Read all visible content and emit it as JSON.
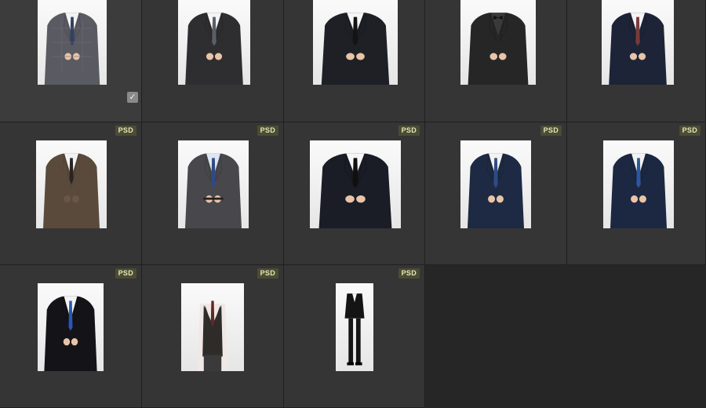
{
  "grid": {
    "background": "#262626",
    "cell_background": "#353535",
    "badge_color": "#4a4d33",
    "items": [
      {
        "badge": "",
        "selected": true,
        "suit": "#5a5a62",
        "tie": "#34405e",
        "shirt": "#f2f2f2",
        "pattern": "check"
      },
      {
        "badge": "",
        "selected": false,
        "suit": "#2e2e30",
        "tie": "#5a5e66",
        "shirt": "#f4f4f4",
        "pattern": "stripe-tie"
      },
      {
        "badge": "",
        "selected": false,
        "suit": "#1f2026",
        "tie": "#141414",
        "shirt": "#f6f6f6",
        "pattern": "plain"
      },
      {
        "badge": "",
        "selected": false,
        "suit": "#262626",
        "tie": "#111111",
        "shirt": "#3a3a3a",
        "pattern": "bowtie"
      },
      {
        "badge": "",
        "selected": false,
        "suit": "#1d2438",
        "tie": "#7a3a36",
        "shirt": "#f4f4f4",
        "pattern": "seated"
      },
      {
        "badge": "PSD",
        "selected": false,
        "suit": "#5a4a3c",
        "tie": "#2a2420",
        "shirt": "#f2f2f2",
        "pattern": "vest"
      },
      {
        "badge": "PSD",
        "selected": false,
        "suit": "#48484c",
        "tie": "#2e4a86",
        "shirt": "#dde6f2",
        "pattern": "belt"
      },
      {
        "badge": "PSD",
        "selected": false,
        "suit": "#1a1c26",
        "tie": "#101010",
        "shirt": "#f6f6f6",
        "pattern": "wide"
      },
      {
        "badge": "PSD",
        "selected": false,
        "suit": "#1e2a44",
        "tie": "#2e4a86",
        "shirt": "#f2f2f2",
        "pattern": "plain"
      },
      {
        "badge": "PSD",
        "selected": false,
        "suit": "#1c2842",
        "tie": "#2e56a0",
        "shirt": "#f2f2f2",
        "pattern": "plain"
      },
      {
        "badge": "PSD",
        "selected": false,
        "suit": "#141418",
        "tie": "#2a56b8",
        "shirt": "#f4f4f4",
        "pattern": "plain"
      },
      {
        "badge": "PSD",
        "selected": false,
        "suit": "#2e2c28",
        "tie": "#5c2a28",
        "shirt": "#f0e8e6",
        "pattern": "waistcoat"
      },
      {
        "badge": "PSD",
        "selected": false,
        "suit": "#141414",
        "tie": "#dddddd",
        "shirt": "#f4f4f4",
        "pattern": "fullbody"
      }
    ]
  }
}
